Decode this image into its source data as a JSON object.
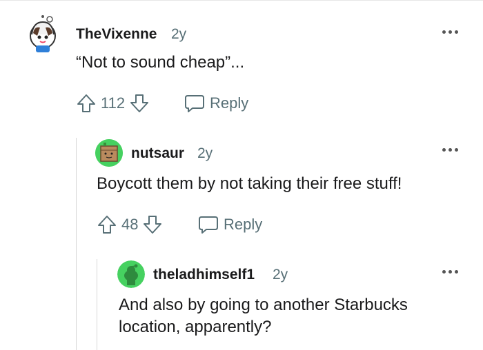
{
  "comments": [
    {
      "author": "TheVixenne",
      "age": "2y",
      "body": "“Not to sound cheap”...",
      "votes": "112",
      "reply_label": "Reply",
      "avatar_icon": "snoo-avatar-white-hood"
    },
    {
      "author": "nutsaur",
      "age": "2y",
      "body": "Boycott them by not taking their free stuff!",
      "votes": "48",
      "reply_label": "Reply",
      "avatar_icon": "box-avatar-green"
    },
    {
      "author": "theladhimself1",
      "age": "2y",
      "body_line1": "And also by going to another Starbucks",
      "body_line2": "location, apparently?",
      "avatar_icon": "snoo-avatar-green"
    }
  ],
  "icons": {
    "upvote": "arrow-up-outline-icon",
    "downvote": "arrow-down-outline-icon",
    "reply": "speech-bubble-icon",
    "more": "ellipsis-horizontal-icon"
  },
  "colors": {
    "muted": "#576f76",
    "avatar_green": "#46d160",
    "thread_line": "#d7d7d7"
  }
}
